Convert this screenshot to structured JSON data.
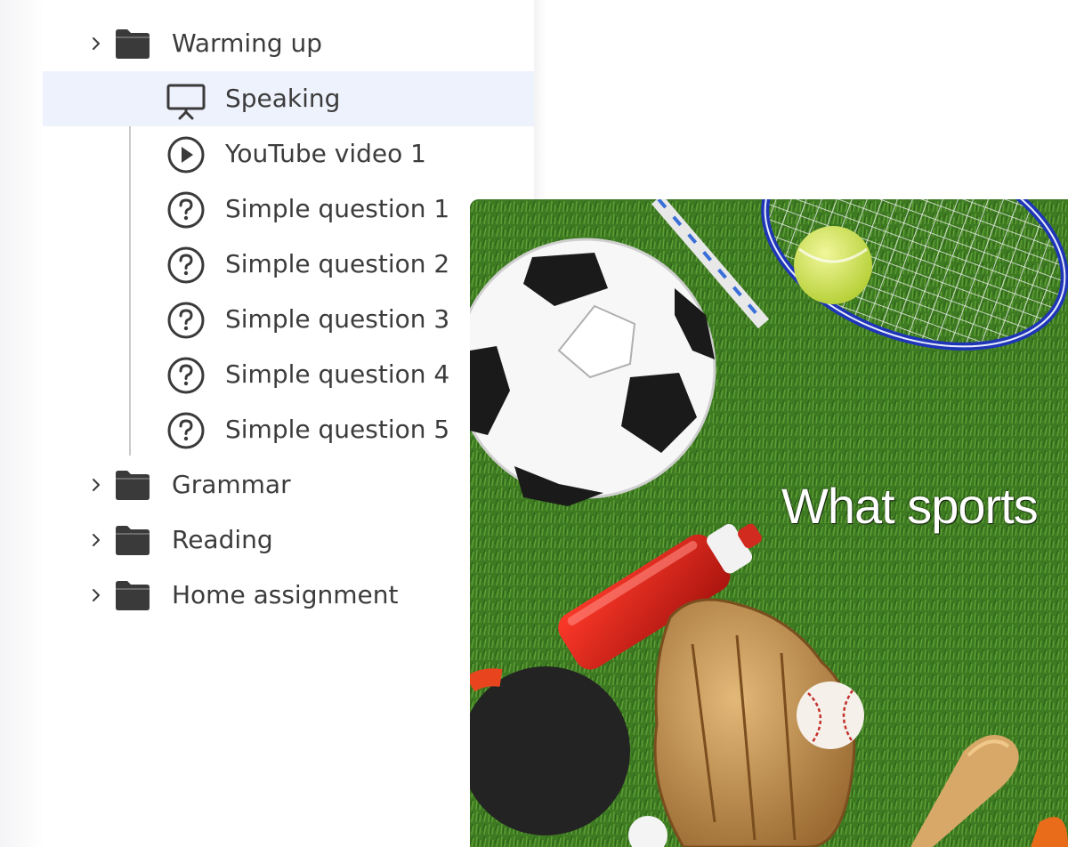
{
  "tree": {
    "folders": [
      {
        "label": "Warming up",
        "expanded": true,
        "icon": "folder-icon"
      },
      {
        "label": "Grammar",
        "expanded": false,
        "icon": "folder-icon"
      },
      {
        "label": "Reading",
        "expanded": false,
        "icon": "folder-icon"
      },
      {
        "label": "Home assignment",
        "expanded": false,
        "icon": "folder-icon"
      }
    ],
    "warming_up_items": [
      {
        "label": "Speaking",
        "icon": "presentation-icon",
        "selected": true
      },
      {
        "label": "YouTube video 1",
        "icon": "play-circle-icon",
        "selected": false
      },
      {
        "label": "Simple question 1",
        "icon": "question-circle-icon",
        "selected": false
      },
      {
        "label": "Simple question 2",
        "icon": "question-circle-icon",
        "selected": false
      },
      {
        "label": "Simple question 3",
        "icon": "question-circle-icon",
        "selected": false
      },
      {
        "label": "Simple question 4",
        "icon": "question-circle-icon",
        "selected": false
      },
      {
        "label": "Simple question 5",
        "icon": "question-circle-icon",
        "selected": false
      }
    ]
  },
  "slide": {
    "text": "What sports"
  },
  "colors": {
    "selected_row": "#eef2fc",
    "icon": "#3a3a3a",
    "text": "#3c3c3c",
    "tree_line": "#c9c9c9"
  }
}
